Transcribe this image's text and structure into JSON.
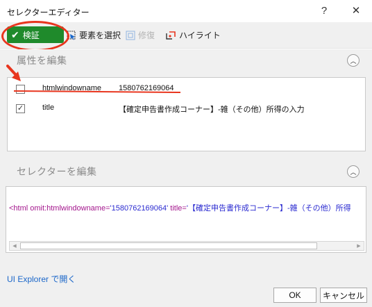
{
  "window": {
    "title": "セレクターエディター",
    "help_label": "?",
    "close_label": "✕"
  },
  "toolbar": {
    "verify_label": "検証",
    "select_element_label": "要素を選択",
    "repair_label": "修復",
    "highlight_label": "ハイライト"
  },
  "attributes_section": {
    "title": "属性を編集",
    "rows": [
      {
        "checked": false,
        "name": "htmlwindowname",
        "value": "1580762169064"
      },
      {
        "checked": true,
        "name": "title",
        "value": "【確定申告書作成コーナー】-雑（その他）所得の入力"
      }
    ]
  },
  "selector_section": {
    "title": "セレクターを編集",
    "selector_parts": {
      "open": "<html ",
      "attr1": "omit:htmlwindowname=",
      "val1": "'1580762169064'",
      "attr2": " title=",
      "val2": "'【確定申告書作成コーナー】-雑（その他）所得"
    }
  },
  "footer": {
    "ui_explorer_link": "UI Explorer で開く",
    "ok_label": "OK",
    "cancel_label": "キャンセル"
  },
  "colors": {
    "verify_green": "#1f8a2b",
    "annotation_red": "#e8351e",
    "link_blue": "#1a66c9"
  }
}
